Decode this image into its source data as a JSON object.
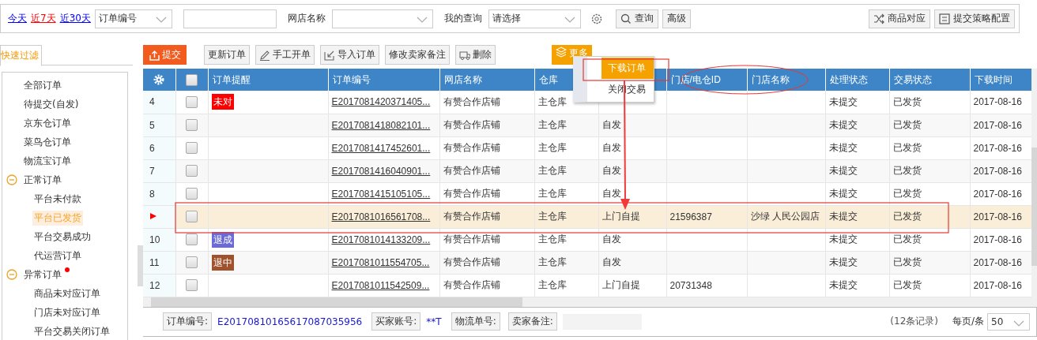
{
  "filter_bar": {
    "quick_dates": [
      {
        "label": "今天",
        "selected": false
      },
      {
        "label": "近7天",
        "selected": true
      },
      {
        "label": "近30天",
        "selected": false
      }
    ],
    "field_select": {
      "value": "订单编号"
    },
    "shop_label": "网店名称",
    "query_label": "我的查询",
    "query_select": {
      "value": "请选择"
    },
    "buttons": [
      {
        "label": "查询"
      },
      {
        "label": "高级"
      }
    ],
    "right_buttons": [
      {
        "label": "商品对应"
      },
      {
        "label": "提交策略配置"
      }
    ]
  },
  "sidebar": {
    "tab": "快速过滤",
    "items": [
      {
        "label": "全部订单",
        "selected": false
      },
      {
        "label": "待提交(自发)",
        "selected": false
      },
      {
        "label": "京东仓订单",
        "selected": false
      },
      {
        "label": "菜鸟仓订单",
        "selected": false
      },
      {
        "label": "物流宝订单",
        "selected": false
      },
      {
        "label": "正常订单",
        "selected": false,
        "expanded": true,
        "alert": false,
        "children": [
          {
            "label": "平台未付款",
            "selected": false
          },
          {
            "label": "平台已发货",
            "selected": true
          },
          {
            "label": "平台交易成功",
            "selected": false
          },
          {
            "label": "代运营订单",
            "selected": false
          }
        ]
      },
      {
        "label": "异常订单",
        "selected": false,
        "expanded": true,
        "alert": true,
        "children": [
          {
            "label": "商品未对应订单",
            "selected": false
          },
          {
            "label": "门店未对应订单",
            "selected": false
          },
          {
            "label": "平台交易关闭订单",
            "selected": false
          }
        ]
      }
    ]
  },
  "toolbar": [
    {
      "label": "提交",
      "kind": "primary"
    },
    {
      "label": "更新订单",
      "kind": "plain"
    },
    {
      "label": "手工开单",
      "kind": "plain"
    },
    {
      "label": "导入订单",
      "kind": "plain"
    },
    {
      "label": "修改卖家备注",
      "kind": "plain"
    },
    {
      "label": "删除",
      "kind": "plain"
    },
    {
      "label": "更多",
      "kind": "more"
    }
  ],
  "more_menu": [
    {
      "label": "下载订单",
      "selected": true
    },
    {
      "label": "关闭交易",
      "selected": false
    }
  ],
  "table": {
    "header_checked": false,
    "reminder_column": "订单提醒",
    "columns": [
      {
        "label": "订单编号"
      },
      {
        "label": "网店名称"
      },
      {
        "label": "仓库"
      },
      {},
      {
        "label": "门店/电仓ID"
      },
      {
        "label": "门店名称"
      },
      {
        "label": "处理状态"
      },
      {
        "label": "交易状态"
      },
      {
        "label": "下载时间"
      }
    ],
    "rows": [
      {
        "number": "4",
        "selected": false,
        "checked": false,
        "tag": {
          "text": "未对",
          "color": "#ff0000"
        },
        "cells": [
          "E2017081420371405...",
          "有赞合作店铺",
          "主仓库",
          null,
          "",
          "",
          "未提交",
          "已发货",
          "2017-08-16"
        ]
      },
      {
        "number": "5",
        "selected": false,
        "checked": false,
        "cells": [
          "E2017081418082101...",
          "有赞合作店铺",
          "主仓库",
          "自发",
          "",
          "",
          "未提交",
          "已发货",
          "2017-08-16"
        ]
      },
      {
        "number": "6",
        "selected": false,
        "checked": false,
        "cells": [
          "E2017081417452601...",
          "有赞合作店铺",
          "主仓库",
          "自发",
          "",
          "",
          "未提交",
          "已发货",
          "2017-08-16"
        ]
      },
      {
        "number": "7",
        "selected": false,
        "checked": false,
        "cells": [
          "E2017081416040901...",
          "有赞合作店铺",
          "主仓库",
          "自发",
          "",
          "",
          "未提交",
          "已发货",
          "2017-08-16"
        ]
      },
      {
        "number": "8",
        "selected": false,
        "checked": false,
        "cells": [
          "E2017081415105105...",
          "有赞合作店铺",
          "主仓库",
          "自发",
          "",
          "",
          "未提交",
          "已发货",
          "2017-08-16"
        ]
      },
      {
        "selected": true,
        "checked": false,
        "cells": [
          "E2017081016561708...",
          "有赞合作店铺",
          "主仓库",
          "上门自提",
          "21596387",
          "沙绿 人民公园店",
          "未提交",
          "已发货",
          "2017-08-16"
        ]
      },
      {
        "number": "10",
        "selected": false,
        "checked": false,
        "tag": {
          "text": "退成",
          "color": "#6b6bd6"
        },
        "cells": [
          "E2017081014133209...",
          "有赞合作店铺",
          "主仓库",
          "自发",
          "",
          "",
          "未提交",
          "已发货",
          "2017-08-16"
        ]
      },
      {
        "number": "11",
        "selected": false,
        "checked": false,
        "tag": {
          "text": "退中",
          "color": "#a0522d"
        },
        "cells": [
          "E2017081011554705...",
          "有赞合作店铺",
          "主仓库",
          "自发",
          "",
          "",
          "未提交",
          "已发货",
          "2017-08-16"
        ]
      },
      {
        "number": "12",
        "selected": false,
        "checked": false,
        "cells": [
          "E2017081011542509...",
          "有赞合作店铺",
          "主仓库",
          "上门自提",
          "20731348",
          "",
          "未提交",
          "已发货",
          "2017-08-16"
        ]
      }
    ]
  },
  "footer": {
    "fields": [
      {
        "label": "订单编号:",
        "value": "E20170810165617087035956"
      },
      {
        "label": "买家账号:",
        "value": "**T"
      },
      {
        "label": "物流单号:"
      },
      {
        "label": "卖家备注:",
        "kind": "box"
      }
    ],
    "record_count": "(12条记录)",
    "page_size_label": "每页/条",
    "page_size": "50"
  },
  "annotations": [
    {
      "kind": "menu-box"
    },
    {
      "kind": "ellipse"
    },
    {
      "kind": "row-box"
    },
    {
      "kind": "arrow"
    }
  ]
}
